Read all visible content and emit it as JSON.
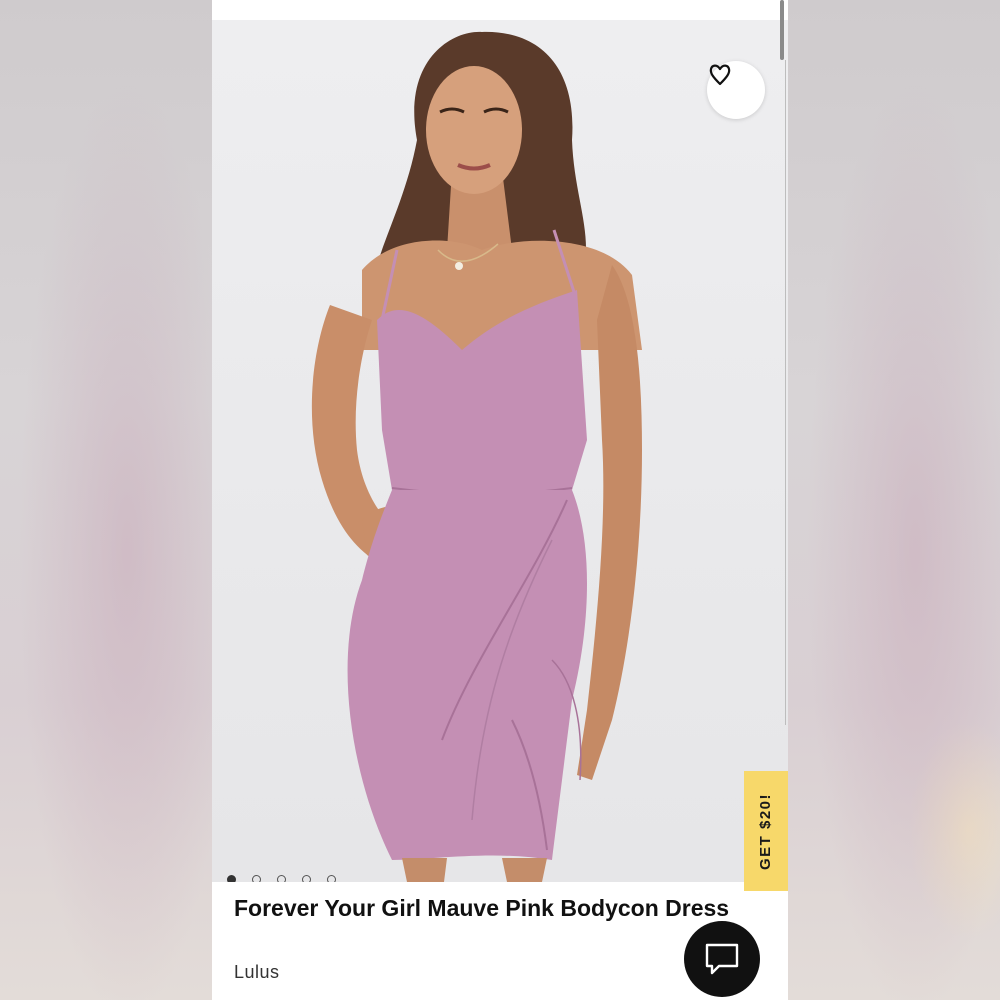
{
  "product": {
    "title": "Forever Your Girl Mauve Pink Bodycon Dress",
    "brand": "Lulus",
    "image_count": 5,
    "active_image": 1,
    "dress_color": "#c48fb4"
  },
  "promo": {
    "label": "GET $20!",
    "color": "#f7d86a"
  },
  "icons": {
    "wishlist": "heart-outline-icon",
    "chat": "chat-bubble-icon"
  }
}
